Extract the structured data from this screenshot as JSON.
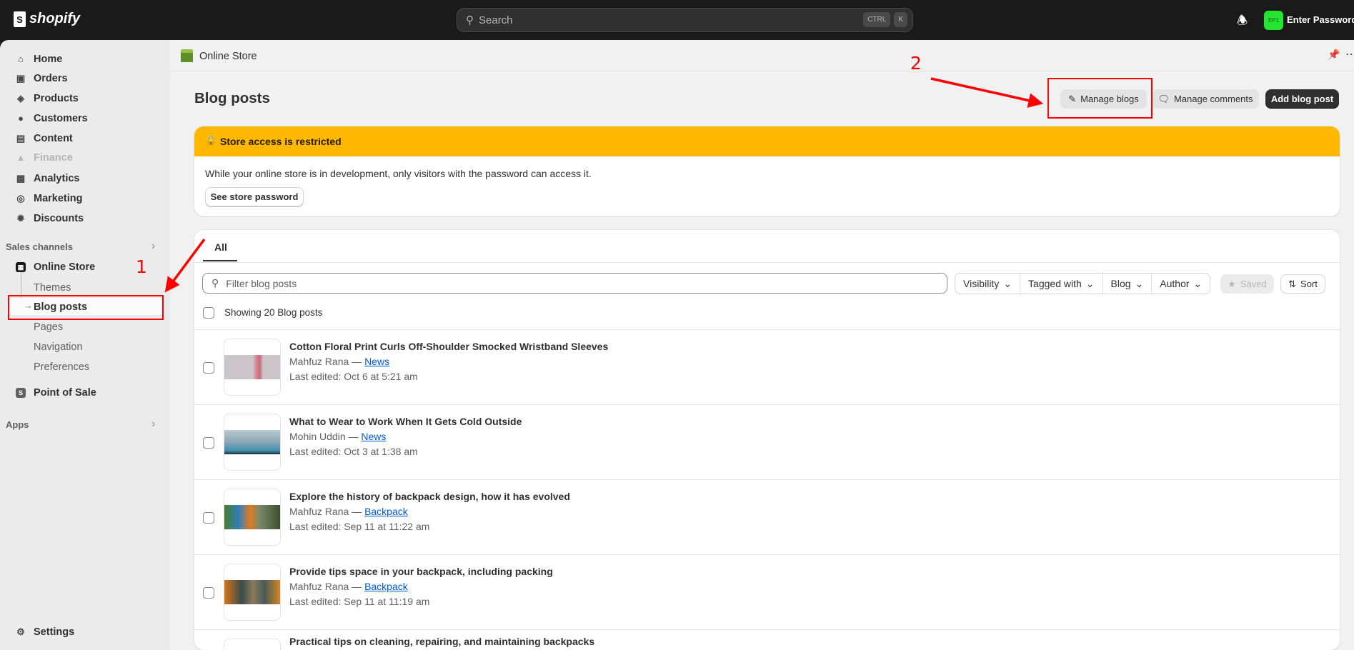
{
  "topbar": {
    "logo": "shopify",
    "search_placeholder": "Search",
    "shortcut": [
      "CTRL",
      "K"
    ],
    "avatar_initials": "EP1",
    "user_name": "Enter Password:"
  },
  "sidebar": {
    "items": [
      {
        "label": "Home"
      },
      {
        "label": "Orders"
      },
      {
        "label": "Products"
      },
      {
        "label": "Customers"
      },
      {
        "label": "Content"
      },
      {
        "label": "Finance"
      },
      {
        "label": "Analytics"
      },
      {
        "label": "Marketing"
      },
      {
        "label": "Discounts"
      }
    ],
    "sales_channels": "Sales channels",
    "online_store": "Online Store",
    "online_store_sub": [
      "Themes",
      "Blog posts",
      "Pages",
      "Navigation",
      "Preferences"
    ],
    "point_of_sale": "Point of Sale",
    "apps": "Apps",
    "settings": "Settings"
  },
  "header": {
    "breadcrumb": "Online Store",
    "title": "Blog posts",
    "manage_blogs": "Manage blogs",
    "manage_comments": "Manage comments",
    "add_blog_post": "Add blog post"
  },
  "banner": {
    "title": "Store access is restricted",
    "body": "While your online store is in development, only visitors with the password can access it.",
    "button": "See store password"
  },
  "list": {
    "tab": "All",
    "filter_placeholder": "Filter blog posts",
    "filters": [
      "Visibility",
      "Tagged with",
      "Blog",
      "Author"
    ],
    "saved": "Saved",
    "sort": "Sort",
    "showing": "Showing 20 Blog posts",
    "posts": [
      {
        "title": "Cotton Floral Print Curls Off-Shoulder Smocked Wristband Sleeves",
        "author": "Mahfuz Rana",
        "blog": "News",
        "edited": "Last edited: Oct 6 at 5:21 am"
      },
      {
        "title": "What to Wear to Work When It Gets Cold Outside",
        "author": "Mohin Uddin",
        "blog": "News",
        "edited": "Last edited: Oct 3 at 1:38 am"
      },
      {
        "title": "Explore the history of backpack design, how it has evolved",
        "author": "Mahfuz Rana",
        "blog": "Backpack",
        "edited": "Last edited: Sep 11 at 11:22 am"
      },
      {
        "title": "Provide tips space in your backpack, including packing",
        "author": "Mahfuz Rana",
        "blog": "Backpack",
        "edited": "Last edited: Sep 11 at 11:19 am"
      },
      {
        "title": "Practical tips on cleaning, repairing, and maintaining backpacks"
      }
    ]
  },
  "annotations": {
    "step1": "1",
    "step2": "2"
  },
  "colors": {
    "banner": "#ffb800",
    "annotation": "#ff0000",
    "link": "#005bd3"
  }
}
